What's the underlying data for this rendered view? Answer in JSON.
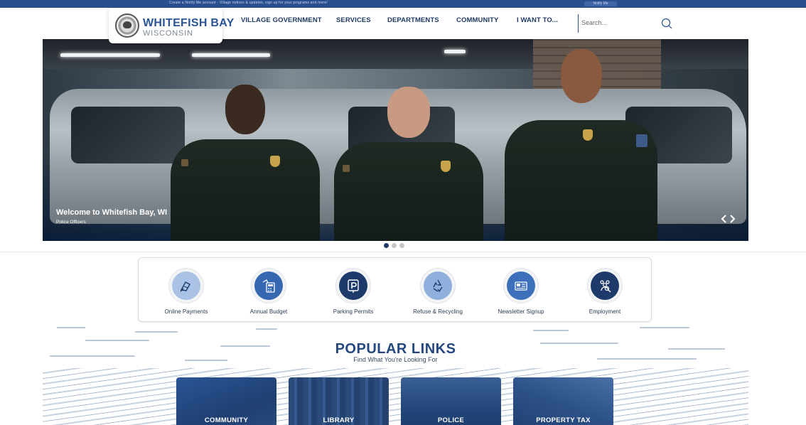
{
  "alert": {
    "text": "Create a Notify Me account - Village notices & updates, sign up for your programs and more!",
    "button_label": "Notify Me"
  },
  "brand": {
    "title": "WHITEFISH BAY",
    "subtitle": "WISCONSIN",
    "seal_icon": "village-seal-icon"
  },
  "nav": {
    "items": [
      {
        "label": "VILLAGE GOVERNMENT"
      },
      {
        "label": "SERVICES"
      },
      {
        "label": "DEPARTMENTS"
      },
      {
        "label": "COMMUNITY"
      },
      {
        "label": "I WANT TO..."
      }
    ]
  },
  "search": {
    "placeholder": "Search...",
    "icon": "search-icon"
  },
  "hero": {
    "caption": "Welcome to Whitefish Bay, WI",
    "subcaption": "Police Officers",
    "prev_icon": "chevron-left-icon",
    "next_icon": "chevron-right-icon",
    "slide_count": 3,
    "active_slide": 1
  },
  "quick_links": [
    {
      "label": "Online Payments",
      "icon": "hand-payment-icon",
      "color": "#5a86c4",
      "light": true
    },
    {
      "label": "Annual Budget",
      "icon": "budget-calculator-icon",
      "color": "#3568b0",
      "light": false
    },
    {
      "label": "Parking Permits",
      "icon": "parking-sign-icon",
      "color": "#1d3a6b",
      "light": false
    },
    {
      "label": "Refuse & Recycling",
      "icon": "recycle-icon",
      "color": "#7fa4d6",
      "light": true
    },
    {
      "label": "Newsletter Signup",
      "icon": "newsletter-icon",
      "color": "#3c70bb",
      "light": false
    },
    {
      "label": "Employment",
      "icon": "employment-people-icon",
      "color": "#1d3a6b",
      "light": false
    }
  ],
  "popular": {
    "title": "POPULAR LINKS",
    "subtitle": "Find What You're Looking For",
    "cards": [
      {
        "label": "COMMUNITY"
      },
      {
        "label": "LIBRARY"
      },
      {
        "label": "POLICE"
      },
      {
        "label": "PROPERTY TAX"
      }
    ]
  },
  "colors": {
    "brand_blue": "#2b5595",
    "nav_text": "#1f3a66",
    "alert_bar": "#2a4f8f"
  }
}
